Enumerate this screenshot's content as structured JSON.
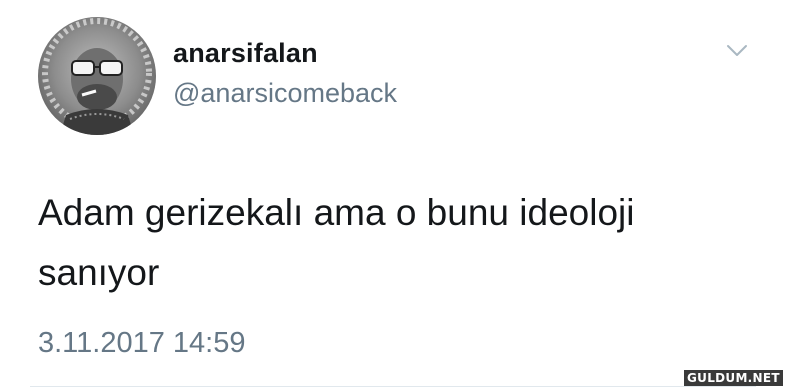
{
  "user": {
    "display_name": "anarsifalan",
    "handle": "@anarsicomeback",
    "avatar_icon": "profile-photo"
  },
  "menu": {
    "icon": "chevron-down-icon"
  },
  "tweet": {
    "line1": "Adam gerizekalı ama o bunu ideoloji",
    "line2": "sanıyor",
    "timestamp": "3.11.2017 14:59"
  },
  "watermark": {
    "text": "GULDUM.NET"
  },
  "colors": {
    "primary_text": "#14171a",
    "secondary_text": "#657786",
    "divider": "#e1e8ed"
  }
}
